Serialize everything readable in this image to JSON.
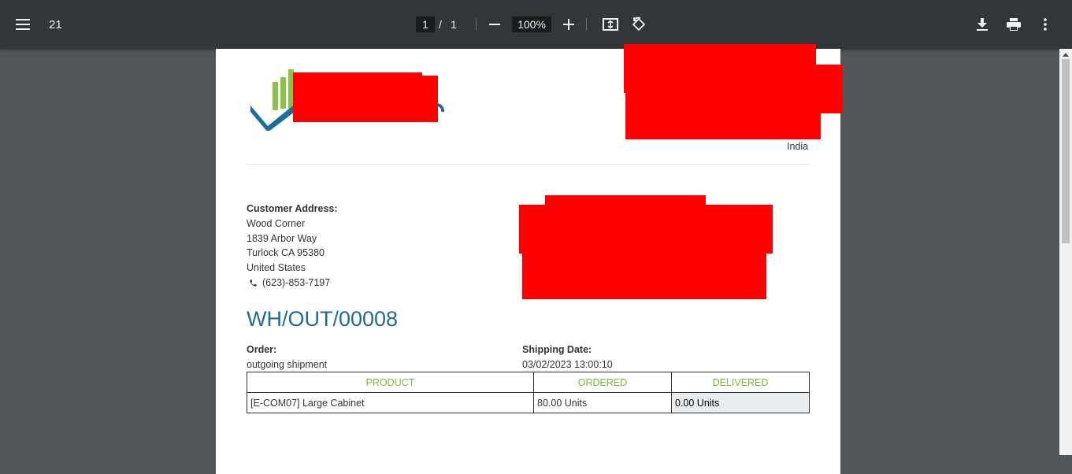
{
  "toolbar": {
    "title": "21",
    "current_page": "1",
    "page_separator": "/",
    "total_pages": "1",
    "zoom": "100%",
    "icons": [
      "menu-icon",
      "zoom-out-icon",
      "zoom-in-icon",
      "fit-page-icon",
      "rotate-icon",
      "download-icon",
      "print-icon",
      "more-vert-icon"
    ]
  },
  "company": {
    "country": "India"
  },
  "customer": {
    "heading": "Customer Address:",
    "name": "Wood Corner",
    "street": "1839 Arbor Way",
    "city_line": "Turlock CA 95380",
    "country": "United States",
    "phone": "(623)-853-7197"
  },
  "document": {
    "reference": "WH/OUT/00008",
    "order_label": "Order:",
    "order_value": "outgoing shipment",
    "shipping_label": "Shipping Date:",
    "shipping_value": "03/02/2023 13:00:10"
  },
  "table": {
    "headers": [
      "PRODUCT",
      "ORDERED",
      "DELIVERED"
    ],
    "rows": [
      {
        "product": "[E-COM07] Large Cabinet",
        "ordered": "80.00 Units",
        "delivered": "0.00 Units"
      }
    ]
  },
  "colors": {
    "toolbar_bg": "#323639",
    "viewer_bg": "#525659",
    "title_blue": "#1f6b96",
    "header_green": "#7cb342",
    "logo_blue": "#1a6f9a",
    "logo_green": "#8bc34a"
  }
}
